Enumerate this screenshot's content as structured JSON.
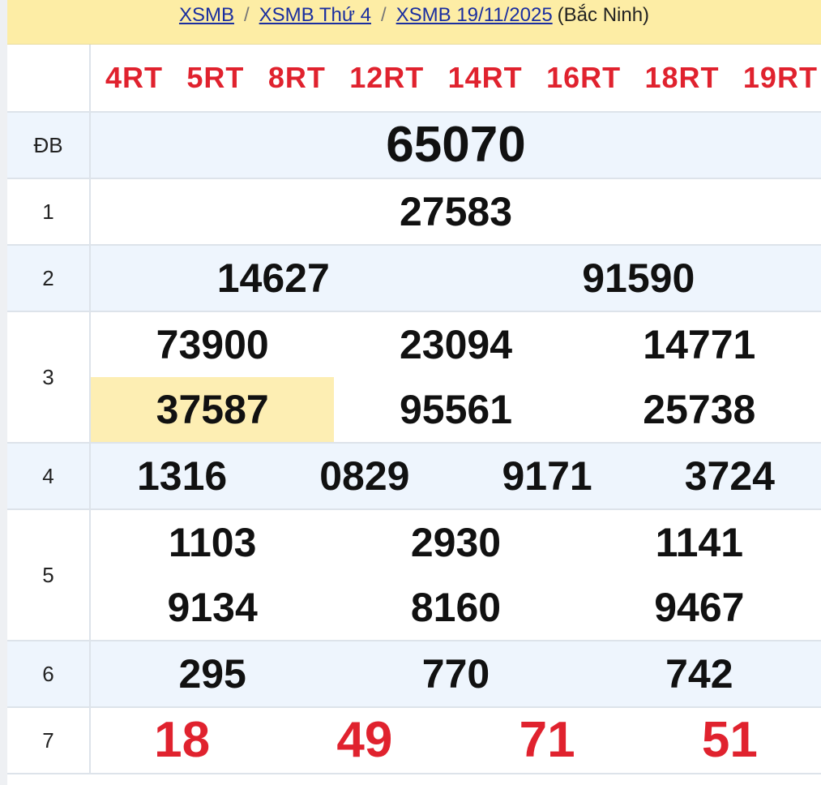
{
  "breadcrumb": {
    "link1": "XSMB",
    "link2": "XSMB Thứ 4",
    "link3": "XSMB 19/11/2025",
    "sep": "/",
    "suffix": "(Bắc Ninh)"
  },
  "codes": [
    "4RT",
    "5RT",
    "8RT",
    "12RT",
    "14RT",
    "16RT",
    "18RT",
    "19RT"
  ],
  "prizes": [
    {
      "label": "ĐB",
      "values": [
        "65070"
      ]
    },
    {
      "label": "1",
      "values": [
        "27583"
      ]
    },
    {
      "label": "2",
      "values": [
        "14627",
        "91590"
      ]
    },
    {
      "label": "3",
      "values": [
        "73900",
        "23094",
        "14771",
        "37587",
        "95561",
        "25738"
      ]
    },
    {
      "label": "4",
      "values": [
        "1316",
        "0829",
        "9171",
        "3724"
      ]
    },
    {
      "label": "5",
      "values": [
        "1103",
        "2930",
        "1141",
        "9134",
        "8160",
        "9467"
      ]
    },
    {
      "label": "6",
      "values": [
        "295",
        "770",
        "742"
      ]
    },
    {
      "label": "7",
      "values": [
        "18",
        "49",
        "71",
        "51"
      ]
    }
  ],
  "colors": {
    "accent_red": "#e0222e",
    "header_bg": "#fdeda5",
    "alt_row_bg": "#eef5fd",
    "highlight_bg": "#fdeeb3",
    "link_blue": "#1a2ea0"
  }
}
